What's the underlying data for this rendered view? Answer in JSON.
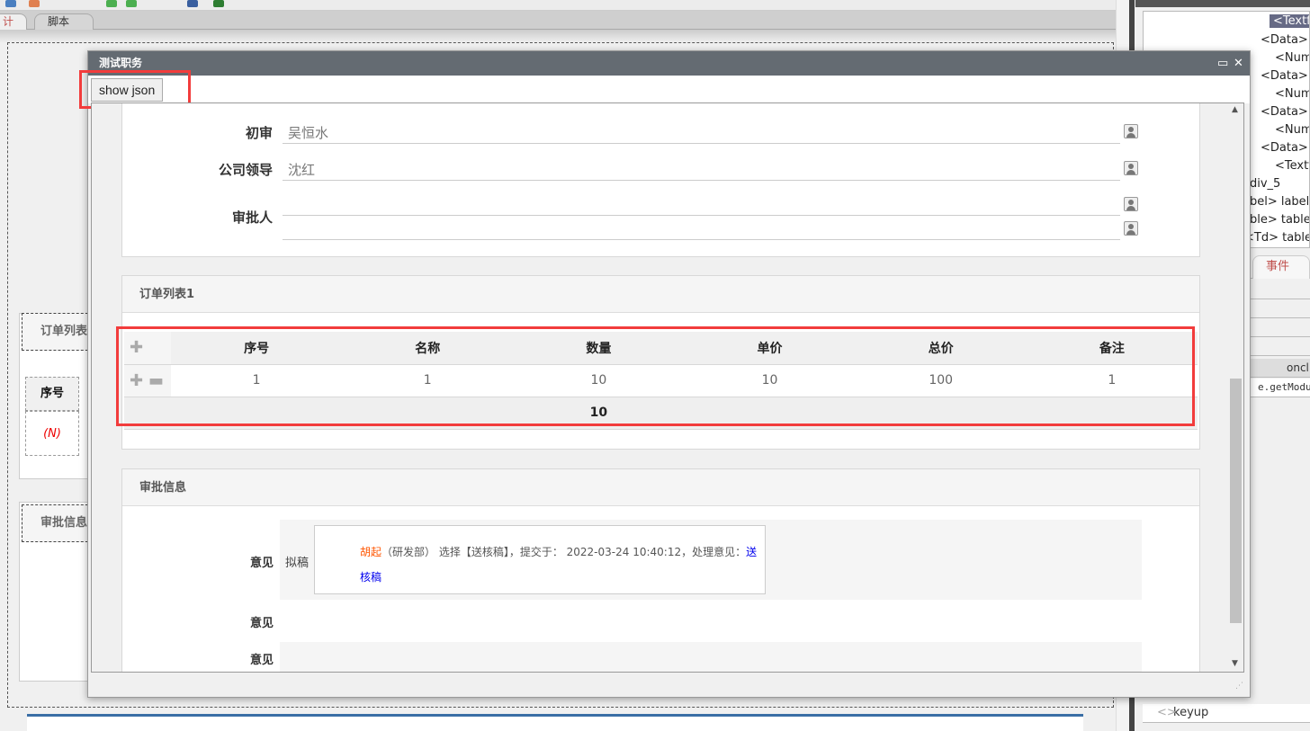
{
  "app": {
    "tabs": [
      {
        "label": "计",
        "active": true
      },
      {
        "label": "脚本",
        "active": false
      }
    ],
    "designer": {
      "section1_title": "订单列表",
      "col_header": "序号",
      "row_placeholder": "(N)",
      "section2_title": "审批信息"
    },
    "right_panel": {
      "tree_items": [
        "<Textf",
        "<Data> c",
        "<Numl",
        "<Data> c",
        "<Numl",
        "<Data> c",
        "<Numl",
        "<Data> c",
        "<Textf",
        "div_5",
        "abel> label_",
        "able> table",
        "<Td> table_"
      ],
      "tab_events": "事件",
      "prop_header": "oncl",
      "prop_value": "e.getModule",
      "event_keyup": "keyup"
    }
  },
  "dialog": {
    "title": "测试职务",
    "show_json_label": "show json",
    "form": {
      "fields": [
        {
          "label": "初审",
          "value": "吴恒水"
        },
        {
          "label": "公司领导",
          "value": "沈红"
        },
        {
          "label": "审批人",
          "value": ""
        }
      ]
    },
    "order_list": {
      "title": "订单列表1",
      "columns": [
        "序号",
        "名称",
        "数量",
        "单价",
        "总价",
        "备注"
      ],
      "rows": [
        [
          "1",
          "1",
          "10",
          "10",
          "100",
          "1"
        ]
      ],
      "footer_total": "10"
    },
    "approval": {
      "title": "审批信息",
      "label": "意见",
      "step": "拟稿",
      "person": "胡起",
      "detail": "（研发部） 选择【送核稿】，提交于： 2022-03-24 10:40:12，处理意见：",
      "opinion": "送核稿",
      "label2": "意见",
      "label3": "意见"
    }
  },
  "colors": {
    "title_bar": "#646b72",
    "highlight": "#f23c3c",
    "person": "#ff5500",
    "opinion": "#0000ee"
  }
}
